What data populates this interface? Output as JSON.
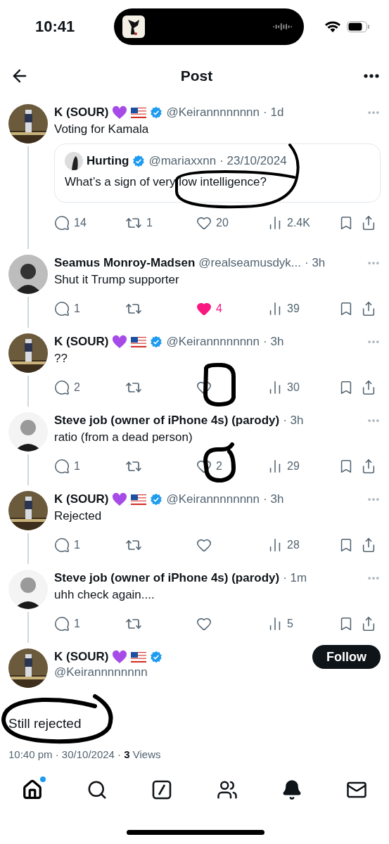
{
  "status_bar": {
    "time": "10:41"
  },
  "header": {
    "title": "Post"
  },
  "replies": [
    {
      "name": "K (SOUR)",
      "emoji": true,
      "verified": true,
      "handle": "@Keirannnnnnnn",
      "time": "· 1d",
      "text": "Voting for Kamala",
      "quote": {
        "name": "Hurting",
        "verified": true,
        "handle": "@mariaxxnn",
        "time": "· 23/10/2024",
        "text": "What’s a sign of very low intelligence?"
      },
      "replies": "14",
      "reposts": "1",
      "likes": "20",
      "liked": false,
      "views": "2.4K"
    },
    {
      "name": "Seamus Monroy-Madsen",
      "emoji": false,
      "verified": false,
      "handle": "@realseamusdyk...",
      "time": "· 3h",
      "text": "Shut it Trump supporter",
      "replies": "1",
      "likes": "4",
      "liked": true,
      "views": "39"
    },
    {
      "name": "K (SOUR)",
      "emoji": true,
      "verified": true,
      "handle": "@Keirannnnnnnn",
      "time": "· 3h",
      "text": "??",
      "replies": "2",
      "liked": false,
      "views": "30"
    },
    {
      "name": "Steve job (owner of iPhone 4s) (parody)",
      "emoji": false,
      "verified": false,
      "time": "· 3h",
      "text": "ratio (from a dead person)",
      "replies": "1",
      "likes": "2",
      "liked": false,
      "views": "29"
    },
    {
      "name": "K (SOUR)",
      "emoji": true,
      "verified": true,
      "handle": "@Keirannnnnnnn",
      "time": "· 3h",
      "text": "Rejected",
      "replies": "1",
      "liked": false,
      "views": "28"
    },
    {
      "name": "Steve job (owner of iPhone 4s) (parody)",
      "emoji": false,
      "verified": false,
      "time": "· 1m",
      "text": "uhh check again....",
      "replies": "1",
      "liked": false,
      "views": "5"
    }
  ],
  "main_post": {
    "name": "K (SOUR)",
    "emoji": true,
    "verified": true,
    "handle": "@Keirannnnnnnn",
    "follow": "Follow",
    "text": "Still rejected",
    "meta": "10:40 pm · 30/10/2024 · ",
    "views_count": "3",
    "views_label": " Views"
  },
  "tab_bar": [
    {
      "kind": "home",
      "selected": true,
      "badge": true
    },
    {
      "kind": "search",
      "selected": false,
      "badge": false
    },
    {
      "kind": "grok",
      "selected": false,
      "badge": false
    },
    {
      "kind": "communities",
      "selected": false,
      "badge": false
    },
    {
      "kind": "notifications",
      "selected": false,
      "badge": false
    },
    {
      "kind": "messages",
      "selected": false,
      "badge": false
    }
  ]
}
